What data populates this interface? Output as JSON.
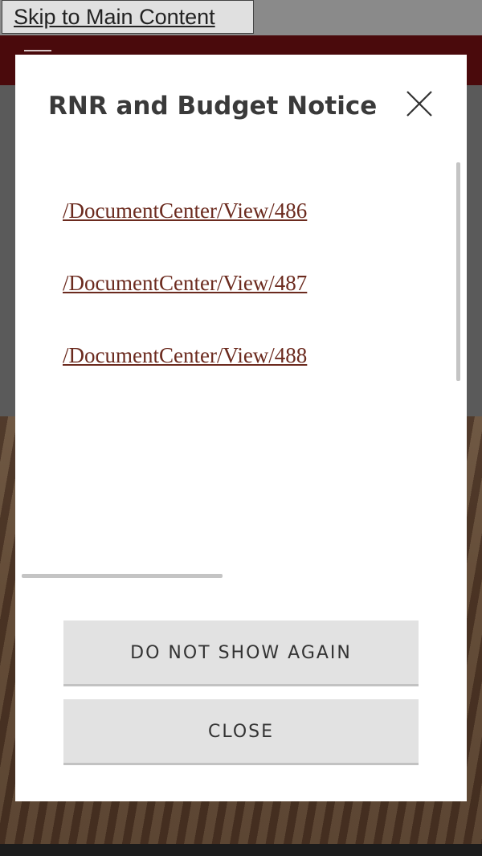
{
  "skip_link": {
    "label": "Skip to Main Content"
  },
  "modal": {
    "title": "RNR and Budget Notice",
    "close_icon": "close-icon",
    "links": [
      {
        "text": "/DocumentCenter/View/486"
      },
      {
        "text": "/DocumentCenter/View/487"
      },
      {
        "text": "/DocumentCenter/View/488"
      }
    ],
    "buttons": {
      "do_not_show_again": "DO NOT SHOW AGAIN",
      "close": "CLOSE"
    }
  },
  "colors": {
    "header": "#4a0a0c",
    "link": "#6b2a1e",
    "button_bg": "#e2e2e2",
    "title": "#3a3a3a"
  }
}
